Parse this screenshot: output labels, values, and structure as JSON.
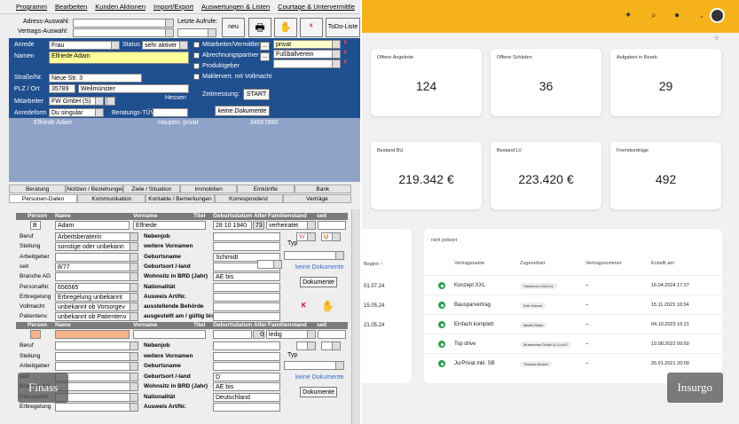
{
  "left": {
    "menu": [
      "Programm",
      "Bearbeiten",
      "Kunden Aktionen",
      "Import/Export",
      "Auswertungen & Listen",
      "Courtage & Untervermittle"
    ],
    "adress_label": "Adress-Auswahl:",
    "vertrags_label": "Vertrags-Auswahl:",
    "letzte_label": "Letzte Aufrufe:",
    "neu_label": "neu",
    "todo_label": "ToDo-Liste",
    "anrede_label": "Anrede",
    "anrede_value": "Frau",
    "status_label": "Status",
    "status_value": "sehr aktiver",
    "namen_label": "Namen",
    "namen_value": "Elfriede Adam",
    "strasse_label": "Straße/Nr.",
    "strasse_value": "Neue Str. 3",
    "plz_label": "PLZ / Ort",
    "plz_value": "35789",
    "ort_value": "Weilmünster",
    "land_value": "Hessen",
    "mitarbeiter_label": "Mitarbeiter",
    "mitarbeiter_value": "FW GmbH (S)",
    "anredeform_label": "Anredeform",
    "anredeform_value": "Du singular",
    "beratungs_label": "Beratungs-TÜV",
    "checks": [
      "Mitarbeiter/Vermittler",
      "Abrechnungspartner",
      "Produktgeber",
      "Maklervert. mit Vollmacht"
    ],
    "privat_value": "privat",
    "fussball_value": "Fußballverein",
    "zeitmessung_label": "Zeitmessung:",
    "start_label": "START",
    "keine_dok_label": "keine Dokumente",
    "info_name": "Elfriede Adam",
    "info_type": "Hauptnr. privat",
    "info_phone": "34567890",
    "tabs1": [
      "Beratung",
      "Notizen / Beziehungen",
      "Ziele / Situation",
      "Immobilien",
      "Einkünfte",
      "Bank"
    ],
    "tabs2": [
      "Personen-Daten",
      "Kommunikation",
      "Kontakte / Bemerkungen",
      "Korrespondenz",
      "Verträge"
    ],
    "headers": [
      "Person",
      "Name",
      "Vorname",
      "Titel",
      "Geburtsdatum",
      "Alter",
      "Familienstand",
      "seit"
    ],
    "p1": {
      "person": "B",
      "name": "Adam",
      "vorname": "Elfriede",
      "geburt": "28 10 1940",
      "alter": "73",
      "stand": "verheiratet",
      "flag_w": "W",
      "flag_u": "U"
    },
    "p1rows": [
      {
        "l": "Beruf",
        "v": "Arbeitsberaterin",
        "m": "Nebenjob",
        "mv": ""
      },
      {
        "l": "Stellung",
        "v": "sonstige oder unbekann",
        "m": "weitere Vornamen",
        "mv": ""
      },
      {
        "l": "Arbeitgeber",
        "v": "",
        "m": "Geburtsname",
        "mv": "Schmidt"
      },
      {
        "l": "seit",
        "v": "8/77",
        "m": "Geburtsort /-land",
        "mv": ""
      },
      {
        "l": "Branche AG",
        "v": "",
        "m": "Wohnsitz in BRD (Jahr)",
        "mv": "AE bis"
      },
      {
        "l": "PersonalNr.",
        "v": "656565",
        "m": "Nationalität",
        "mv": ""
      },
      {
        "l": "Erbregelung",
        "v": "Erbregelung unbekannt",
        "m": "Ausweis Art/Nr.",
        "mv": ""
      },
      {
        "l": "Vollmacht",
        "v": "unbekannt ob Vorsorgev",
        "m": "ausstellende Behörde",
        "mv": ""
      },
      {
        "l": "Patientenv.",
        "v": "unbekannt ob Patientenv",
        "m": "ausgestellt am / gültig bis",
        "mv": ""
      }
    ],
    "typ_label": "Typ",
    "keine_dok2": "keine Dokumente",
    "dokumente_label": "Dokumente",
    "p2": {
      "alter": "0",
      "stand": "ledig"
    },
    "p2rows": [
      {
        "l": "Beruf",
        "v": "",
        "m": "Nebenjob",
        "mv": ""
      },
      {
        "l": "Stellung",
        "v": "",
        "m": "weitere Vornamen",
        "mv": ""
      },
      {
        "l": "Arbeitgeber",
        "v": "",
        "m": "Geburtsname",
        "mv": ""
      },
      {
        "l": "seit",
        "v": "",
        "m": "Geburtsort /-land",
        "mv": "D"
      },
      {
        "l": "Branche AG",
        "v": "",
        "m": "Wohnsitz in BRD (Jahr)",
        "mv": "AE bis"
      },
      {
        "l": "PersonalNr.",
        "v": "",
        "m": "Nationalität",
        "mv": "Deutschland"
      },
      {
        "l": "Erbregelung",
        "v": "",
        "m": "Ausweis Art/Nr.",
        "mv": ""
      }
    ],
    "badge": "Finass"
  },
  "right": {
    "badge": "Insurgo",
    "cards": [
      {
        "title": "Offene Angebote",
        "value": "124"
      },
      {
        "title": "Offene Schäden",
        "value": "36"
      },
      {
        "title": "Aufgaben in Bearb.",
        "value": "29"
      },
      {
        "title": "Bestand BU",
        "value": "219.342 €"
      },
      {
        "title": "Bestand LV",
        "value": "223.420 €"
      },
      {
        "title": "Fremdverträge",
        "value": "492"
      }
    ],
    "side_header": "Beginn ↑",
    "side_dates": [
      "01.07.24",
      "15.05.24",
      "21.05.24"
    ],
    "filter_label": "nicht policiert",
    "columns": [
      "Vertragsname",
      "Zugeordnet",
      "Vertragsnummer",
      "Erstellt am"
    ],
    "rows": [
      {
        "name": "Konzept XXL",
        "zug": "Stachbom USA Inc",
        "nr": "–",
        "date": "16.04.2024 17:27"
      },
      {
        "name": "Bausparvertrag",
        "zug": "Dirk Holand",
        "nr": "–",
        "date": "15.11.2023 10:34"
      },
      {
        "name": "Einfach komplett",
        "zug": "Martin Maier",
        "nr": "–",
        "date": "04.10.2023 10:21"
      },
      {
        "name": "Top drive",
        "zug": "Musterman GmbH & Co.KG",
        "nr": "–",
        "date": "19.08.2022 09:50"
      },
      {
        "name": "JurPrivat inkl. SB",
        "zug": "Thomas Becker",
        "nr": "–",
        "date": "26.01.2021 20:00"
      }
    ]
  }
}
